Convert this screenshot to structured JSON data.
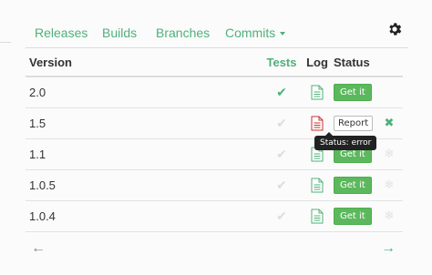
{
  "nav": {
    "tabs": [
      {
        "label": "Releases"
      },
      {
        "label": "Builds"
      },
      {
        "label": "Branches"
      },
      {
        "label": "Commits"
      }
    ],
    "settings_icon": "gear-icon"
  },
  "table": {
    "headers": {
      "version": "Version",
      "tests": "Tests",
      "log": "Log",
      "status": "Status"
    },
    "rows": [
      {
        "version": "2.0",
        "tests": "passed",
        "log_state": "ok",
        "status_label": "Get it",
        "extra": ""
      },
      {
        "version": "1.5",
        "tests": "none",
        "log_state": "error",
        "status_label": "Report",
        "extra": "remove"
      },
      {
        "version": "1.1",
        "tests": "none",
        "log_state": "ok",
        "status_label": "Get it",
        "extra": "pending"
      },
      {
        "version": "1.0.5",
        "tests": "none",
        "log_state": "ok",
        "status_label": "Get it",
        "extra": "pending"
      },
      {
        "version": "1.0.4",
        "tests": "none",
        "log_state": "ok",
        "status_label": "Get it",
        "extra": "pending"
      }
    ]
  },
  "tooltip": {
    "text": "Status: error"
  },
  "pager": {
    "prev": "←",
    "next": "→"
  },
  "colors": {
    "accent": "#4fb07a",
    "button": "#5cb85c",
    "error": "#c9302c"
  }
}
